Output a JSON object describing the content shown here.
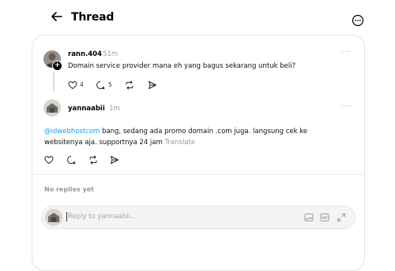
{
  "header": {
    "title": "Thread"
  },
  "post": {
    "username": "rann.404",
    "time": "51m",
    "more": "···",
    "text": "Domain service provider mana eh yang bagus sekarang untuk beli?",
    "like_count": "4",
    "comment_count": "5"
  },
  "reply": {
    "username": "yannaabii",
    "time": "1m",
    "more": "···",
    "mention": "@idwebhostcom",
    "text_line1_rest": " bang, sedang ada promo domain .com juga. langsung cek ke",
    "text_line2": "websitenya aja. supportnya 24 jam",
    "translate": "Translate"
  },
  "replies_section": {
    "empty_text": "No replies yet"
  },
  "composer": {
    "placeholder": "Reply to yannaabii..."
  },
  "icons": {
    "back": "arrow-left-icon",
    "header_more": "more-circle-icon",
    "like": "heart-icon",
    "comment": "comment-icon",
    "repost": "repost-icon",
    "share": "send-icon",
    "image": "image-icon",
    "gif": "gif-icon",
    "expand": "expand-icon"
  }
}
